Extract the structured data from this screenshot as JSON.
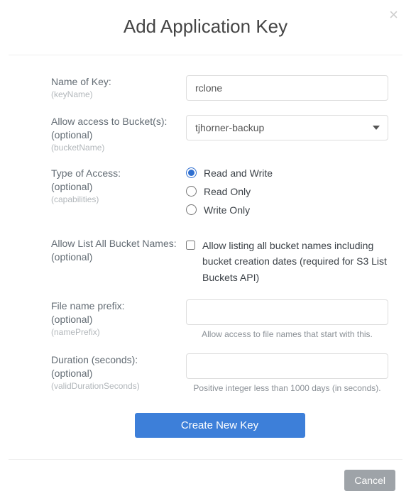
{
  "modal": {
    "title": "Add Application Key",
    "close_symbol": "×"
  },
  "fields": {
    "nameOfKey": {
      "label": "Name of Key:",
      "tech": "(keyName)",
      "value": "rclone"
    },
    "bucket": {
      "label": "Allow access to Bucket(s):",
      "optional": "(optional)",
      "tech": "(bucketName)",
      "selected": "tjhorner-backup"
    },
    "access": {
      "label": "Type of Access:",
      "optional": "(optional)",
      "tech": "(capabilities)",
      "options": {
        "rw": "Read and Write",
        "ro": "Read Only",
        "wo": "Write Only"
      }
    },
    "listBuckets": {
      "label": "Allow List All Bucket Names:",
      "optional": "(optional)",
      "checkbox_text": "Allow listing all bucket names including bucket creation dates (required for S3 List Buckets API)"
    },
    "prefix": {
      "label": "File name prefix:",
      "optional": "(optional)",
      "tech": "(namePrefix)",
      "value": "",
      "hint": "Allow access to file names that start with this."
    },
    "duration": {
      "label": "Duration (seconds):",
      "optional": "(optional)",
      "tech": "(validDurationSeconds)",
      "value": "",
      "hint": "Positive integer less than 1000 days (in seconds)."
    }
  },
  "buttons": {
    "submit": "Create New Key",
    "cancel": "Cancel"
  }
}
